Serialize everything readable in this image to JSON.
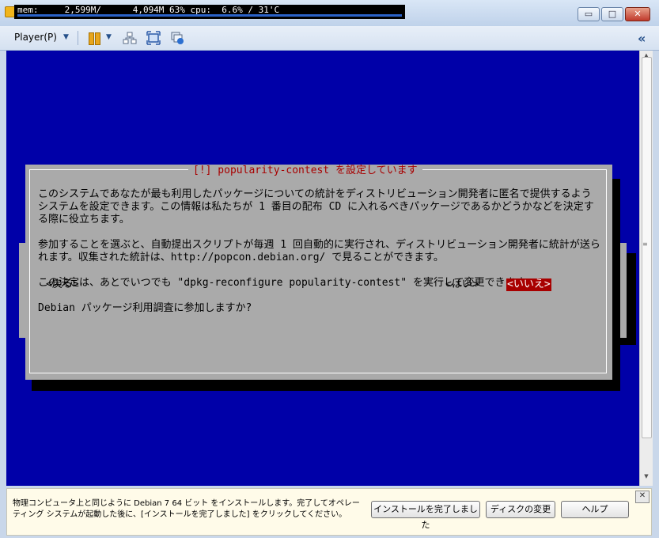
{
  "window": {
    "sysmon_text": "mem:     2,599M/      4,094M 63% cpu:  6.6% / 31'C",
    "minimize": "▭",
    "maximize": "□",
    "close": "✕"
  },
  "toolbar": {
    "player_menu": "Player(P)",
    "caret": "▼",
    "collapse": "«"
  },
  "dialog": {
    "title": "[!] popularity-contest を設定しています",
    "paragraphs": [
      "このシステムであなたが最も利用したパッケージについての統計をディストリビューション開発者に匿名で提供するようシステムを設定できます。この情報は私たちが 1 番目の配布 CD に入れるべきパッケージであるかどうかなどを決定する際に役立ちます。",
      "参加することを選ぶと、自動提出スクリプトが毎週 1 回自動的に実行され、ディストリビューション開発者に統計が送られます。収集された統計は、http://popcon.debian.org/ で見ることができます。",
      "この決定は、あとでいつでも \"dpkg-reconfigure popularity-contest\" を実行して変更できます。",
      "Debian パッケージ利用調査に参加しますか?"
    ],
    "back_button": "<戻る>",
    "yes_button": "<はい>",
    "no_button": "<いいえ>"
  },
  "hintbar": {
    "text": "物理コンピュータ上と同じように Debian 7 64 ビット をインストールします。完了してオペレーティング システムが起動した後に、[インストールを完了しました] をクリックしてください。",
    "finish_button": "インストールを完了しました",
    "disk_button": "ディスクの変更",
    "help_button": "ヘルプ",
    "close": "✕"
  },
  "colors": {
    "screen_bg": "#0000a8",
    "dialog_bg": "#aaaaaa",
    "title_fg": "#a80000",
    "selected_bg": "#a80000"
  }
}
